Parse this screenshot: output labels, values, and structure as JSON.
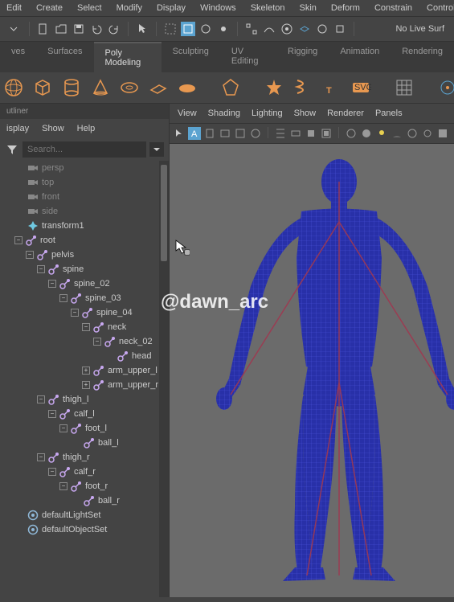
{
  "menubar": [
    "Edit",
    "Create",
    "Select",
    "Modify",
    "Display",
    "Windows",
    "Skeleton",
    "Skin",
    "Deform",
    "Constrain",
    "Control"
  ],
  "toolbar": {
    "no_live": "No Live Surf"
  },
  "tabs": [
    "ves",
    "Surfaces",
    "Poly Modeling",
    "Sculpting",
    "UV Editing",
    "Rigging",
    "Animation",
    "Rendering"
  ],
  "active_tab": 2,
  "outliner": {
    "title": "utliner",
    "menu": [
      "isplay",
      "Show",
      "Help"
    ],
    "search_placeholder": "Search...",
    "cameras": [
      "persp",
      "top",
      "front",
      "side"
    ],
    "transform": "transform1",
    "hierarchy": [
      {
        "n": "root",
        "d": 0,
        "exp": true
      },
      {
        "n": "pelvis",
        "d": 1,
        "exp": true
      },
      {
        "n": "spine",
        "d": 2,
        "exp": true
      },
      {
        "n": "spine_02",
        "d": 3,
        "exp": true
      },
      {
        "n": "spine_03",
        "d": 4,
        "exp": true
      },
      {
        "n": "spine_04",
        "d": 5,
        "exp": true
      },
      {
        "n": "neck",
        "d": 6,
        "exp": true
      },
      {
        "n": "neck_02",
        "d": 7,
        "exp": true
      },
      {
        "n": "head",
        "d": 8,
        "exp": false,
        "leaf": true
      },
      {
        "n": "arm_upper_l",
        "d": 6,
        "exp": false,
        "closed": true
      },
      {
        "n": "arm_upper_r",
        "d": 6,
        "exp": false,
        "closed": true
      },
      {
        "n": "thigh_l",
        "d": 2,
        "exp": true
      },
      {
        "n": "calf_l",
        "d": 3,
        "exp": true
      },
      {
        "n": "foot_l",
        "d": 4,
        "exp": true
      },
      {
        "n": "ball_l",
        "d": 5,
        "exp": false,
        "leaf": true
      },
      {
        "n": "thigh_r",
        "d": 2,
        "exp": true
      },
      {
        "n": "calf_r",
        "d": 3,
        "exp": true
      },
      {
        "n": "foot_r",
        "d": 4,
        "exp": true
      },
      {
        "n": "ball_r",
        "d": 5,
        "exp": false,
        "leaf": true
      }
    ],
    "sets": [
      "defaultLightSet",
      "defaultObjectSet"
    ]
  },
  "viewport": {
    "menu": [
      "View",
      "Shading",
      "Lighting",
      "Show",
      "Renderer",
      "Panels"
    ]
  },
  "watermark": "@dawn_arc"
}
